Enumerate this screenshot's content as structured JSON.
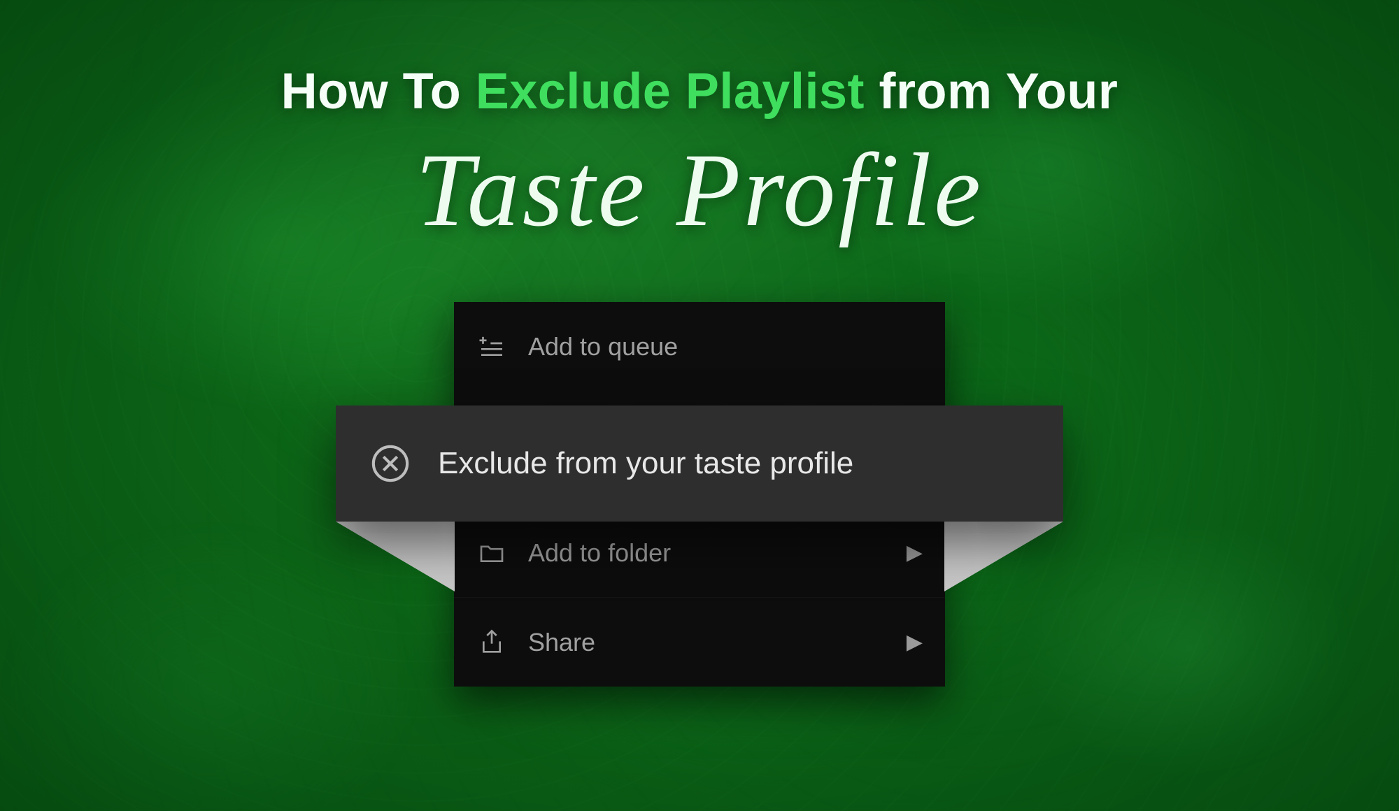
{
  "title": {
    "part1": "How To ",
    "part2": "Exclude Playlist",
    "part3": " from Your",
    "line2": "Taste Profile"
  },
  "menu": {
    "add_to_queue": "Add to queue",
    "exclude": "Exclude from your taste profile",
    "add_to_folder": "Add to folder",
    "share": "Share"
  }
}
